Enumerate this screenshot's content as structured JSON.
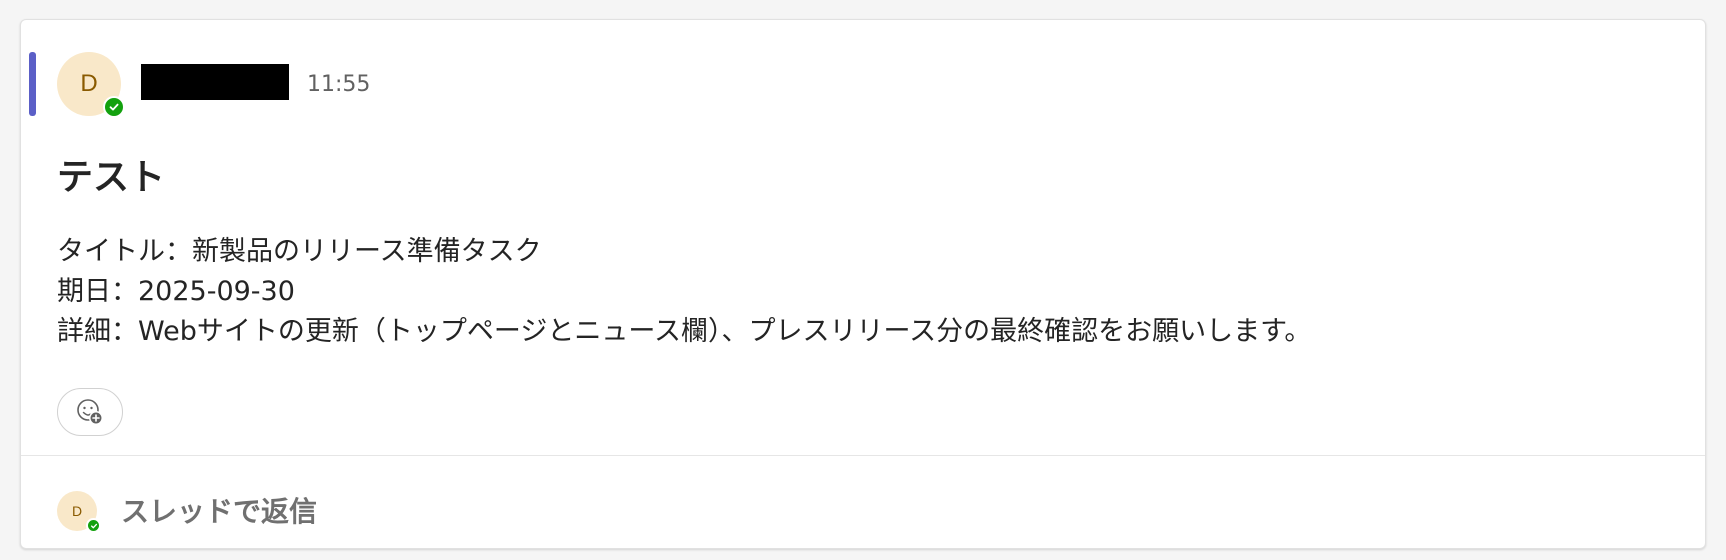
{
  "message": {
    "avatar_initial": "D",
    "time": "11:55",
    "title": "テスト",
    "body_lines": [
      "タイトル：新製品のリリース準備タスク",
      "期日：2025-09-30",
      "詳細：Webサイトの更新（トップページとニュース欄）、プレスリリース分の最終確認をお願いします。"
    ]
  },
  "reply": {
    "avatar_initial": "D",
    "label": "スレッドで返信"
  },
  "icons": {
    "presence": "check-circle-icon",
    "reaction": "add-reaction-icon"
  },
  "colors": {
    "accent": "#5b5fc7",
    "presence_available": "#13a10e",
    "avatar_bg": "#f9e8c9",
    "avatar_fg": "#8a5a00"
  }
}
